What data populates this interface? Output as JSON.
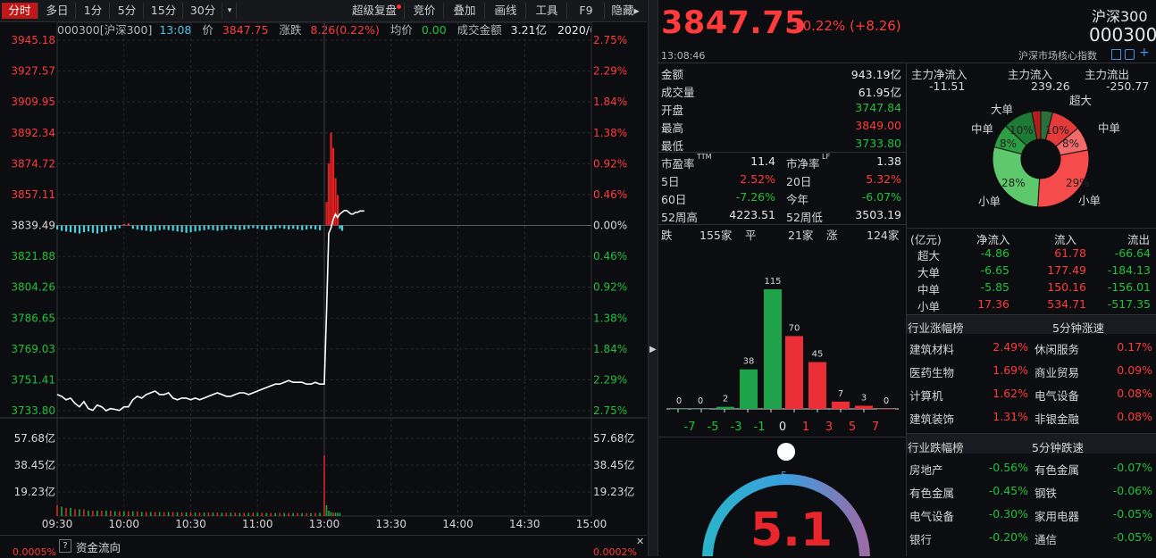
{
  "toolbar": {
    "tabs": [
      "分时",
      "多日",
      "1分",
      "5分",
      "15分",
      "30分",
      "▾"
    ],
    "right": [
      "超级复盘",
      "竞价",
      "叠加",
      "画线",
      "工具",
      "F9",
      "隐藏▸"
    ]
  },
  "info": {
    "code_name": "000300[沪深300]",
    "time": "13:08",
    "price_label": "价",
    "price": "3847.75",
    "change_label": "涨跌",
    "change": "8.26(0.22%)",
    "avg_label": "均价",
    "avg": "0.00",
    "amount_label": "成交金额",
    "amount": "3.21亿",
    "date": "2020/0..."
  },
  "chart_data": {
    "type": "line",
    "title": "",
    "price_axis": [
      "3945.18",
      "3927.57",
      "3909.95",
      "3892.34",
      "3874.72",
      "3857.11",
      "3839.49",
      "3821.88",
      "3804.26",
      "3786.65",
      "3769.03",
      "3751.41",
      "3733.80"
    ],
    "pct_axis": [
      "2.75%",
      "2.29%",
      "1.84%",
      "1.38%",
      "0.92%",
      "0.46%",
      "0.00%",
      "0.46%",
      "0.92%",
      "1.38%",
      "1.84%",
      "2.29%",
      "2.75%"
    ],
    "volume_axis": [
      "57.68亿",
      "38.45亿",
      "19.23亿"
    ],
    "time_axis": [
      "09:30",
      "10:00",
      "10:30",
      "11:00",
      "13:00",
      "13:30",
      "14:00",
      "14:30",
      "15:00"
    ],
    "ylim": [
      3733.8,
      3945.18
    ],
    "prev_close": 3839.49,
    "series": [
      {
        "x_minutes": [
          0,
          2,
          4,
          6,
          8,
          10,
          12,
          14,
          16,
          18,
          20,
          22,
          24,
          26,
          28,
          30,
          32,
          34,
          36,
          38,
          40,
          42,
          44,
          46,
          48,
          50,
          52,
          54,
          56,
          58,
          60,
          62,
          64,
          66,
          68,
          70,
          72,
          74,
          76,
          78,
          80,
          82,
          84,
          86,
          88,
          90,
          92,
          94,
          96,
          98,
          100,
          102,
          104,
          106,
          108,
          110,
          112,
          114,
          116,
          118,
          120,
          121,
          122,
          123,
          124,
          125,
          126,
          127,
          128,
          129,
          130,
          131,
          132,
          133,
          134,
          135,
          136,
          137,
          138
        ],
        "values": [
          3743,
          3742,
          3740,
          3741,
          3738,
          3736,
          3739,
          3735,
          3734,
          3737,
          3736,
          3733.8,
          3735,
          3734.5,
          3734,
          3736,
          3736,
          3740,
          3742,
          3741,
          3743,
          3744,
          3745,
          3743,
          3743,
          3744,
          3741,
          3740,
          3741,
          3741,
          3740,
          3741,
          3740,
          3741,
          3742,
          3743,
          3744,
          3743,
          3742,
          3742,
          3743,
          3744,
          3744,
          3743,
          3744,
          3745,
          3746,
          3747,
          3748,
          3749,
          3749,
          3750,
          3751,
          3750,
          3750,
          3750,
          3749,
          3749,
          3750,
          3749,
          3749,
          3790,
          3835,
          3838,
          3843,
          3846,
          3844,
          3846,
          3847,
          3848,
          3848,
          3847,
          3846,
          3846,
          3847,
          3847,
          3847.75,
          3847.75,
          3847.75
        ]
      }
    ],
    "bars_minutes": [
      0,
      2,
      4,
      6,
      8,
      10,
      12,
      14,
      16,
      18,
      20,
      22,
      24,
      26,
      28,
      30,
      32,
      34,
      36,
      38,
      40,
      42,
      44,
      46,
      48,
      50,
      52,
      54,
      56,
      58,
      60,
      62,
      64,
      66,
      68,
      70,
      72,
      74,
      76,
      78,
      80,
      82,
      84,
      86,
      88,
      90,
      92,
      94,
      96,
      98,
      100,
      102,
      104,
      106,
      108,
      110,
      112,
      114,
      116,
      118
    ],
    "bars_pct": [
      -0.06,
      -0.08,
      -0.09,
      -0.1,
      -0.11,
      -0.12,
      -0.1,
      -0.09,
      -0.11,
      -0.12,
      -0.1,
      -0.09,
      -0.07,
      -0.06,
      -0.04,
      0.02,
      0.03,
      -0.05,
      -0.06,
      -0.07,
      -0.08,
      -0.09,
      -0.08,
      -0.07,
      -0.06,
      -0.07,
      -0.08,
      -0.09,
      -0.1,
      -0.11,
      -0.1,
      -0.09,
      -0.08,
      -0.07,
      -0.06,
      -0.07,
      -0.08,
      -0.07,
      -0.06,
      -0.05,
      -0.06,
      -0.07,
      -0.06,
      -0.05,
      -0.04,
      -0.05,
      -0.06,
      -0.07,
      -0.06,
      -0.05,
      -0.04,
      -0.05,
      -0.06,
      -0.05,
      -0.06,
      -0.07,
      -0.06,
      -0.05,
      -0.06,
      -0.07
    ],
    "spike_minutes": [
      121,
      122,
      123,
      124,
      125,
      126,
      127,
      128
    ],
    "spike_pct": [
      0.35,
      0.92,
      1.38,
      1.15,
      0.7,
      0.45,
      -0.05,
      -0.08
    ],
    "volume_bars": [
      {
        "t": 0,
        "v": 8
      },
      {
        "t": 2,
        "v": 7
      },
      {
        "t": 4,
        "v": 6
      },
      {
        "t": 6,
        "v": 6
      },
      {
        "t": 8,
        "v": 5
      },
      {
        "t": 10,
        "v": 5
      },
      {
        "t": 12,
        "v": 5
      },
      {
        "t": 14,
        "v": 4
      },
      {
        "t": 16,
        "v": 4
      },
      {
        "t": 18,
        "v": 4
      },
      {
        "t": 20,
        "v": 4
      },
      {
        "t": 22,
        "v": 4
      },
      {
        "t": 24,
        "v": 4
      },
      {
        "t": 26,
        "v": 3.5
      },
      {
        "t": 28,
        "v": 3.5
      },
      {
        "t": 30,
        "v": 3.5
      },
      {
        "t": 32,
        "v": 3.5
      },
      {
        "t": 34,
        "v": 3.5
      },
      {
        "t": 36,
        "v": 3.5
      },
      {
        "t": 38,
        "v": 3
      },
      {
        "t": 40,
        "v": 3
      },
      {
        "t": 42,
        "v": 3
      },
      {
        "t": 44,
        "v": 3
      },
      {
        "t": 46,
        "v": 3
      },
      {
        "t": 48,
        "v": 3
      },
      {
        "t": 50,
        "v": 3
      },
      {
        "t": 52,
        "v": 3
      },
      {
        "t": 54,
        "v": 2.8
      },
      {
        "t": 56,
        "v": 2.8
      },
      {
        "t": 58,
        "v": 2.8
      },
      {
        "t": 60,
        "v": 2.8
      },
      {
        "t": 62,
        "v": 2.6
      },
      {
        "t": 64,
        "v": 2.6
      },
      {
        "t": 66,
        "v": 2.6
      },
      {
        "t": 68,
        "v": 2.6
      },
      {
        "t": 70,
        "v": 2.6
      },
      {
        "t": 72,
        "v": 2.6
      },
      {
        "t": 74,
        "v": 2.5
      },
      {
        "t": 76,
        "v": 2.5
      },
      {
        "t": 78,
        "v": 2.5
      },
      {
        "t": 80,
        "v": 2.5
      },
      {
        "t": 82,
        "v": 2.4
      },
      {
        "t": 84,
        "v": 2.4
      },
      {
        "t": 86,
        "v": 2.4
      },
      {
        "t": 88,
        "v": 2.4
      },
      {
        "t": 90,
        "v": 2.4
      },
      {
        "t": 92,
        "v": 2.4
      },
      {
        "t": 94,
        "v": 2.3
      },
      {
        "t": 96,
        "v": 2.3
      },
      {
        "t": 98,
        "v": 2.3
      },
      {
        "t": 100,
        "v": 2.3
      },
      {
        "t": 102,
        "v": 2.3
      },
      {
        "t": 104,
        "v": 2.3
      },
      {
        "t": 106,
        "v": 2.2
      },
      {
        "t": 108,
        "v": 2.2
      },
      {
        "t": 110,
        "v": 2.2
      },
      {
        "t": 112,
        "v": 2.2
      },
      {
        "t": 114,
        "v": 2.2
      },
      {
        "t": 116,
        "v": 2.3
      },
      {
        "t": 118,
        "v": 2.5
      },
      {
        "t": 120,
        "v": 45
      },
      {
        "t": 121,
        "v": 8
      },
      {
        "t": 122,
        "v": 4
      },
      {
        "t": 123,
        "v": 3
      },
      {
        "t": 124,
        "v": 2.5
      },
      {
        "t": 125,
        "v": 2.5
      },
      {
        "t": 126,
        "v": 2.5
      },
      {
        "t": 127,
        "v": 2.3
      }
    ]
  },
  "fund_flow": {
    "help": "?",
    "title": "资金流向",
    "left": "0.0005%",
    "right": "0.0002%",
    "close": "✕"
  },
  "quote": {
    "price": "3847.75",
    "change": "+0.22% (+8.26)",
    "name": "沪深300",
    "code": "000300",
    "time": "13:08:46",
    "index_type": "沪深市场核心指数"
  },
  "stats": [
    {
      "label": "金额",
      "value": "943.19亿",
      "color": "white"
    },
    {
      "label": "成交量",
      "value": "61.95亿",
      "color": "white"
    },
    {
      "label": "开盘",
      "value": "3747.84",
      "color": "green"
    },
    {
      "label": "最高",
      "value": "3849.00",
      "color": "red"
    },
    {
      "label": "最低",
      "value": "3733.80",
      "color": "green"
    }
  ],
  "ratios": [
    {
      "l1": "市盈率",
      "s1": "TTM",
      "v1": "11.4",
      "c1": "white",
      "l2": "市净率",
      "s2": "LF",
      "v2": "1.38",
      "c2": "white"
    },
    {
      "l1": "5日",
      "s1": "",
      "v1": "2.52%",
      "c1": "red",
      "l2": "20日",
      "s2": "",
      "v2": "5.32%",
      "c2": "red"
    },
    {
      "l1": "60日",
      "s1": "",
      "v1": "-7.26%",
      "c1": "green",
      "l2": "今年",
      "s2": "",
      "v2": "-6.07%",
      "c2": "green"
    },
    {
      "l1": "52周高",
      "s1": "",
      "v1": "4223.51",
      "c1": "white",
      "l2": "52周低",
      "s2": "",
      "v2": "3503.19",
      "c2": "white"
    }
  ],
  "breadth": {
    "down_label": "跌",
    "down": "155家",
    "flat_label": "平",
    "flat": "21家",
    "up_label": "涨",
    "up": "124家"
  },
  "dist_chart": {
    "type": "bar",
    "categories": [
      "-7",
      "-5",
      "-3",
      "-1",
      "0",
      "1",
      "3",
      "5",
      "7"
    ],
    "values": [
      0,
      0,
      2,
      38,
      115,
      70,
      45,
      7,
      3,
      0
    ],
    "bins": [
      "≤-7",
      "-7~-5",
      "-5~-3",
      "-3~-1",
      "-1~0",
      "0~1",
      "1~3",
      "3~5",
      "5~7",
      "≥7"
    ],
    "ylim": [
      0,
      115
    ]
  },
  "gauge": {
    "value": "5.1",
    "marker": "5",
    "min": 0,
    "max": 10
  },
  "mainflow": {
    "headers": [
      "主力净流入",
      "主力流入",
      "主力流出"
    ],
    "values": [
      "-11.51",
      "239.26",
      "-250.77"
    ],
    "colors": [
      "green",
      "red",
      "green"
    ]
  },
  "donut": {
    "type": "pie",
    "labels": [
      "超大",
      "中单",
      "小单",
      "小单",
      "中单",
      "大单"
    ],
    "slices": [
      {
        "label": "超大",
        "pct": 4,
        "color": "#2a6e3a"
      },
      {
        "label": "",
        "pct": 10,
        "color": "#e43a3a"
      },
      {
        "label": "",
        "pct": 8,
        "color": "#f26a6a"
      },
      {
        "label": "",
        "pct": 29,
        "color": "#f54b4b"
      },
      {
        "label": "",
        "pct": 28,
        "color": "#5ec96c"
      },
      {
        "label": "",
        "pct": 8,
        "color": "#2e9e44"
      },
      {
        "label": "",
        "pct": 10,
        "color": "#1c7a34"
      },
      {
        "label": "",
        "pct": 3,
        "color": "#b51d1d"
      }
    ],
    "pct_text": [
      "10%",
      "8%",
      "29%",
      "28%",
      "8%",
      "10%"
    ]
  },
  "flow_table": {
    "headers": [
      "(亿元)",
      "净流入",
      "流入",
      "流出"
    ],
    "rows": [
      {
        "name": "超大",
        "net": "-4.86",
        "in": "61.78",
        "out": "-66.64",
        "nc": "green"
      },
      {
        "name": "大单",
        "net": "-6.65",
        "in": "177.49",
        "out": "-184.13",
        "nc": "green"
      },
      {
        "name": "中单",
        "net": "-5.85",
        "in": "150.16",
        "out": "-156.01",
        "nc": "green"
      },
      {
        "name": "小单",
        "net": "17.36",
        "in": "534.71",
        "out": "-517.35",
        "nc": "red"
      }
    ]
  },
  "industry_up": {
    "title": "行业涨幅榜",
    "title2": "5分钟涨速",
    "rows": [
      {
        "a": "建筑材料",
        "av": "2.49%",
        "b": "休闲服务",
        "bv": "0.17%"
      },
      {
        "a": "医药生物",
        "av": "1.69%",
        "b": "商业贸易",
        "bv": "0.09%"
      },
      {
        "a": "计算机",
        "av": "1.62%",
        "b": "电气设备",
        "bv": "0.08%"
      },
      {
        "a": "建筑装饰",
        "av": "1.31%",
        "b": "非银金融",
        "bv": "0.08%"
      }
    ]
  },
  "industry_down": {
    "title": "行业跌幅榜",
    "title2": "5分钟跌速",
    "rows": [
      {
        "a": "房地产",
        "av": "-0.56%",
        "b": "有色金属",
        "bv": "-0.07%"
      },
      {
        "a": "有色金属",
        "av": "-0.45%",
        "b": "钢铁",
        "bv": "-0.06%"
      },
      {
        "a": "电气设备",
        "av": "-0.30%",
        "b": "家用电器",
        "bv": "-0.05%"
      },
      {
        "a": "银行",
        "av": "-0.20%",
        "b": "通信",
        "bv": "-0.05%"
      }
    ]
  },
  "colors": {
    "up": "#ff3b3b",
    "down": "#21c13a",
    "bg": "#0c0d10",
    "accent": "#c01818"
  }
}
